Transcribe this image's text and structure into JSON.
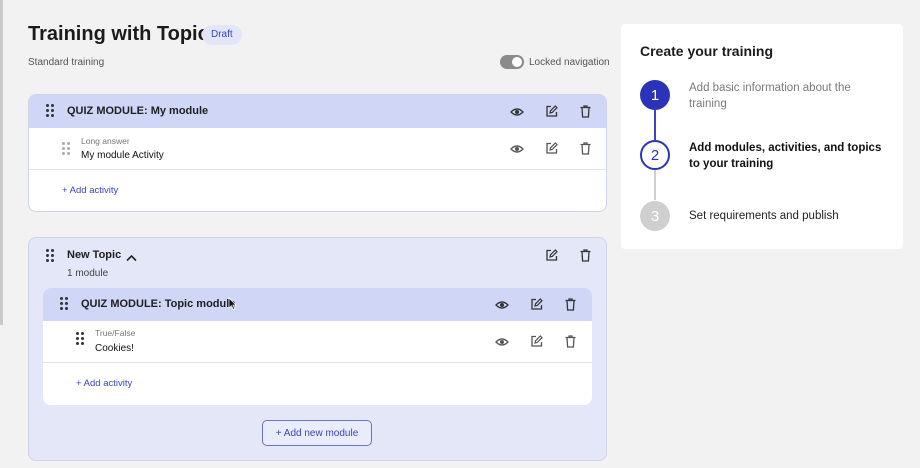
{
  "header": {
    "title": "Training with Topic",
    "badge": "Draft",
    "subtitle": "Standard training",
    "locked_nav_label": "Locked navigation"
  },
  "module1": {
    "title": "QUIZ MODULE: My module",
    "activity": {
      "type": "Long answer",
      "name": "My module Activity"
    },
    "add_activity": "+ Add activity"
  },
  "topic": {
    "title": "New Topic",
    "subtitle": "1 module",
    "module": {
      "title": "QUIZ MODULE: Topic module",
      "activity": {
        "type": "True/False",
        "name": "Cookies!"
      },
      "add_activity": "+ Add activity"
    },
    "add_module": "+ Add new module"
  },
  "steps": {
    "title": "Create your training",
    "items": [
      {
        "num": "1",
        "label": "Add basic information about the training",
        "state": "done"
      },
      {
        "num": "2",
        "label": "Add modules, activities, and topics to your training",
        "state": "current"
      },
      {
        "num": "3",
        "label": "Set requirements and publish",
        "state": "todo"
      }
    ]
  },
  "colors": {
    "accent": "#2b34b8",
    "module_header": "#cfd6f6",
    "topic_bg": "#e3e7f8"
  }
}
